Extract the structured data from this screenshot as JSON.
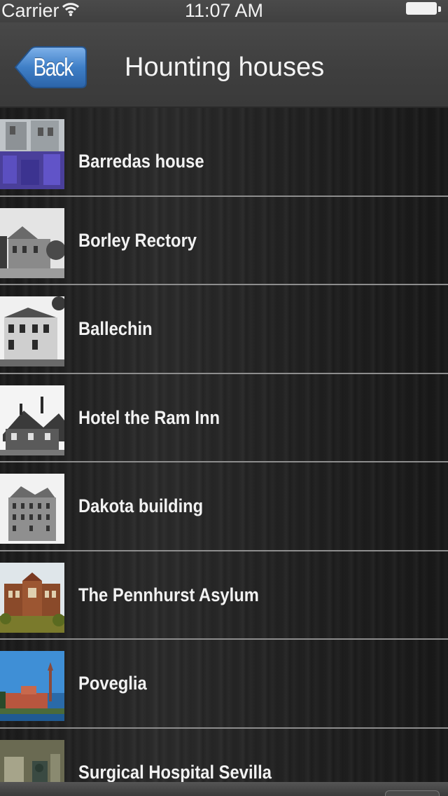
{
  "status_bar": {
    "carrier": "Carrier",
    "time": "11:07 AM"
  },
  "nav": {
    "back_label": "Back",
    "title": "Hounting houses"
  },
  "houses": [
    {
      "name": "Barredas house",
      "thumb": "purple-flowers-house"
    },
    {
      "name": "Borley Rectory",
      "thumb": "bw-rectory"
    },
    {
      "name": "Ballechin",
      "thumb": "bw-mansion"
    },
    {
      "name": "Hotel the Ram Inn",
      "thumb": "bw-timber-inn"
    },
    {
      "name": "Dakota building",
      "thumb": "bw-apartment-block"
    },
    {
      "name": "The Pennhurst Asylum",
      "thumb": "brick-asylum"
    },
    {
      "name": "Poveglia",
      "thumb": "island-blue-sky"
    },
    {
      "name": "Surgical Hospital Sevilla",
      "thumb": "hospital-interior"
    }
  ],
  "colors": {
    "bar": "#444444",
    "list_background": "#222222",
    "separator": "#8d8d8d",
    "back_button": "#3f7fc7",
    "text": "#f2f2f2"
  }
}
